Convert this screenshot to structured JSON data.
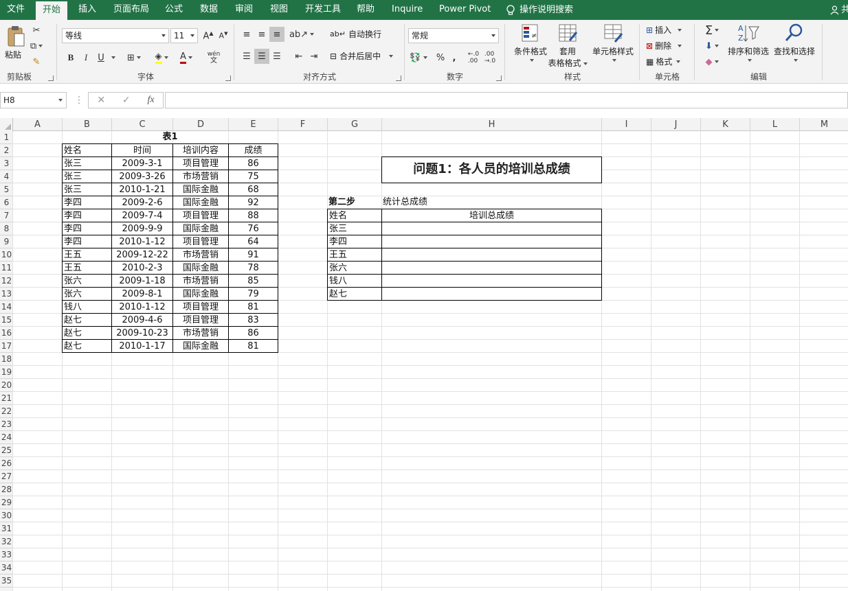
{
  "tabs": [
    "文件",
    "开始",
    "插入",
    "页面布局",
    "公式",
    "数据",
    "审阅",
    "视图",
    "开发工具",
    "帮助",
    "Inquire",
    "Power Pivot"
  ],
  "active_tab": "开始",
  "search_hint": "操作说明搜索",
  "share_label": "共",
  "ribbon": {
    "clipboard": {
      "paste": "粘贴",
      "label": "剪贴板"
    },
    "font": {
      "name": "等线",
      "size": "11",
      "label": "字体",
      "bold": "B",
      "italic": "I",
      "underline": "U",
      "phonetic": "wén"
    },
    "align": {
      "wrap": "自动换行",
      "merge": "合并后居中",
      "label": "对齐方式"
    },
    "number": {
      "format": "常规",
      "percent": "%",
      "comma": ",",
      "label": "数字"
    },
    "styles": {
      "cond": "条件格式",
      "table1": "套用",
      "table2": "表格格式",
      "cell": "单元格样式",
      "label": "样式"
    },
    "cells": {
      "insert": "插入",
      "delete": "删除",
      "format": "格式",
      "label": "单元格"
    },
    "edit": {
      "sort": "排序和筛选",
      "find": "查找和选择",
      "label": "编辑"
    }
  },
  "formula_bar": {
    "name_box": "H8",
    "fx": "fx",
    "content": ""
  },
  "columns": [
    "A",
    "B",
    "C",
    "D",
    "E",
    "F",
    "G",
    "H",
    "I",
    "J",
    "K",
    "L",
    "M"
  ],
  "rows": [
    "1",
    "2",
    "3",
    "4",
    "5",
    "6",
    "7",
    "8",
    "9",
    "10",
    "11",
    "12",
    "13",
    "14",
    "15",
    "16",
    "17",
    "18",
    "19",
    "20",
    "21",
    "22",
    "23",
    "24",
    "25",
    "26",
    "27",
    "28",
    "29",
    "30",
    "31",
    "32",
    "33",
    "34",
    "35"
  ],
  "table1": {
    "title": "表1",
    "headers": [
      "姓名",
      "时间",
      "培训内容",
      "成绩"
    ],
    "rows": [
      [
        "张三",
        "2009-3-1",
        "项目管理",
        "86"
      ],
      [
        "张三",
        "2009-3-26",
        "市场营销",
        "75"
      ],
      [
        "张三",
        "2010-1-21",
        "国际金融",
        "68"
      ],
      [
        "李四",
        "2009-2-6",
        "国际金融",
        "92"
      ],
      [
        "李四",
        "2009-7-4",
        "项目管理",
        "88"
      ],
      [
        "李四",
        "2009-9-9",
        "国际金融",
        "76"
      ],
      [
        "李四",
        "2010-1-12",
        "项目管理",
        "64"
      ],
      [
        "王五",
        "2009-12-22",
        "市场营销",
        "91"
      ],
      [
        "王五",
        "2010-2-3",
        "国际金融",
        "78"
      ],
      [
        "张六",
        "2009-1-18",
        "市场营销",
        "85"
      ],
      [
        "张六",
        "2009-8-1",
        "国际金融",
        "79"
      ],
      [
        "钱八",
        "2010-1-12",
        "项目管理",
        "81"
      ],
      [
        "赵七",
        "2009-4-6",
        "项目管理",
        "83"
      ],
      [
        "赵七",
        "2009-10-23",
        "市场营销",
        "86"
      ],
      [
        "赵七",
        "2010-1-17",
        "国际金融",
        "81"
      ]
    ]
  },
  "question": "问题1：各人员的培训总成绩",
  "step": {
    "label": "第二步",
    "text": "统计总成绩"
  },
  "summary": {
    "headers": [
      "姓名",
      "培训总成绩"
    ],
    "names": [
      "张三",
      "李四",
      "王五",
      "张六",
      "钱八",
      "赵七"
    ]
  }
}
